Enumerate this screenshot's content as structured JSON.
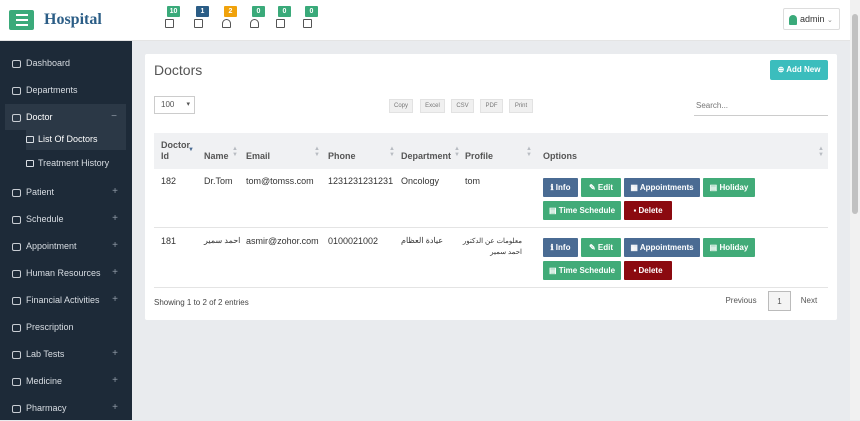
{
  "app": {
    "brand": "Hospital",
    "user": "admin"
  },
  "toolbar": {
    "items": [
      {
        "icon": "bed-icon",
        "count": "10",
        "color": "#3aaa7a"
      },
      {
        "icon": "money-icon",
        "count": "1",
        "color": "#2b5d86"
      },
      {
        "icon": "patient-icon",
        "count": "2",
        "color": "#f0a20b"
      },
      {
        "icon": "doctor-icon",
        "count": "0",
        "color": "#3aaa7a"
      },
      {
        "icon": "medkit-icon",
        "count": "0",
        "color": "#3aaa7a"
      },
      {
        "icon": "prescription-icon",
        "count": "0",
        "color": "#3aaa7a"
      }
    ]
  },
  "sidebar": {
    "items": [
      {
        "label": "Dashboard",
        "icon": "dashboard-icon"
      },
      {
        "label": "Departments",
        "icon": "sitemap-icon"
      },
      {
        "label": "Doctor",
        "icon": "users-icon",
        "toggle": "−"
      },
      {
        "label": "Patient",
        "icon": "users-icon",
        "toggle": "+"
      },
      {
        "label": "Schedule",
        "icon": "stethoscope-icon",
        "toggle": "+"
      },
      {
        "label": "Appointment",
        "icon": "stethoscope-icon",
        "toggle": "+"
      },
      {
        "label": "Human Resources",
        "icon": "users-icon",
        "toggle": "+"
      },
      {
        "label": "Financial Activities",
        "icon": "dollar-icon",
        "toggle": "+"
      },
      {
        "label": "Prescription",
        "icon": "stethoscope-icon"
      },
      {
        "label": "Lab Tests",
        "icon": "flask-icon",
        "toggle": "+"
      },
      {
        "label": "Medicine",
        "icon": "medkit-icon",
        "toggle": "+"
      },
      {
        "label": "Pharmacy",
        "icon": "dollar-icon",
        "toggle": "+"
      }
    ],
    "doctor_sub": [
      {
        "label": "List Of Doctors",
        "icon": "user-icon"
      },
      {
        "label": "Treatment History",
        "icon": "history-icon"
      }
    ]
  },
  "main": {
    "title": "Doctors",
    "add_label": "⊕ Add New",
    "length_value": "100",
    "export_buttons": [
      "Copy",
      "Excel",
      "CSV",
      "PDF",
      "Print"
    ],
    "search_placeholder": "Search...",
    "columns": [
      "Doctor Id",
      "Name",
      "Email",
      "Phone",
      "Department",
      "Profile",
      "Options"
    ],
    "rows": [
      {
        "id": "182",
        "name": "Dr.Tom",
        "email": "tom@tomss.com",
        "phone": "1231231231231",
        "department": "Oncology",
        "profile": "tom"
      },
      {
        "id": "181",
        "name": "احمد سمير",
        "email": "asmir@zohor.com",
        "phone": "0100021002",
        "department": "عيادة العظام",
        "profile": "معلومات عن الدكتور احمد سمير"
      }
    ],
    "actions": {
      "info": "ℹ Info",
      "edit": "✎ Edit",
      "appointments": "▦ Appointments",
      "holiday": "▤ Holiday",
      "time_schedule": "▤ Time Schedule",
      "delete": "▪ Delete"
    },
    "showing": "Showing 1 to 2 of 2 entries",
    "pagination": {
      "previous": "Previous",
      "current": "1",
      "next": "Next"
    }
  }
}
